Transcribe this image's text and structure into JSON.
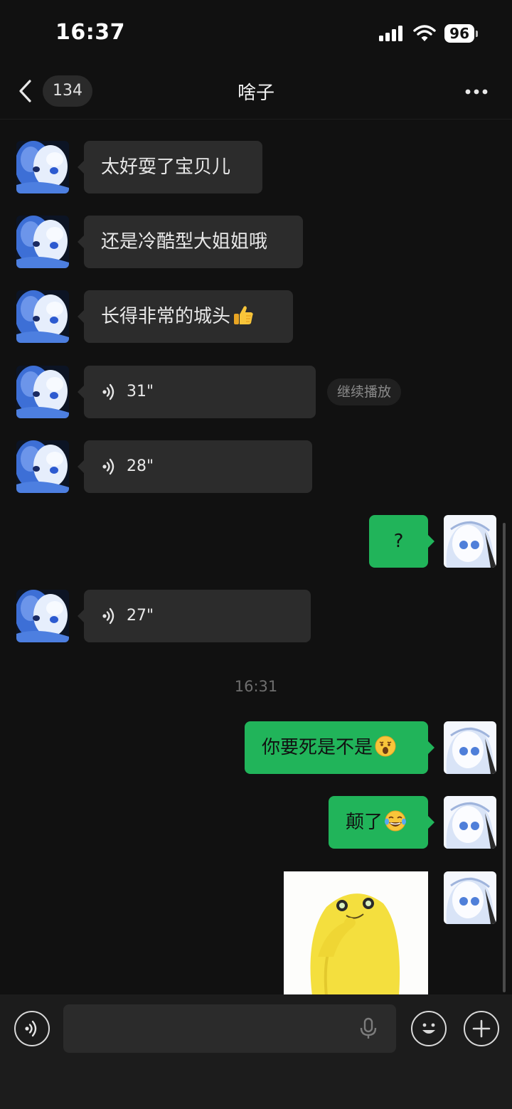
{
  "status_bar": {
    "time": "16:37",
    "battery": "96"
  },
  "nav": {
    "unread_count": "134",
    "title": "啥子"
  },
  "messages": [
    {
      "side": "in",
      "type": "text",
      "text": "太好耍了宝贝儿"
    },
    {
      "side": "in",
      "type": "text",
      "text": "还是冷酷型大姐姐哦"
    },
    {
      "side": "in",
      "type": "text",
      "text": "长得非常的城头",
      "emoji": "thumbs-up"
    },
    {
      "side": "in",
      "type": "voice",
      "duration": "31\"",
      "continue_label": "继续播放"
    },
    {
      "side": "in",
      "type": "voice",
      "duration": "28\""
    },
    {
      "side": "out",
      "type": "text",
      "text": "?"
    },
    {
      "side": "in",
      "type": "voice",
      "duration": "27\""
    },
    {
      "type": "timestamp",
      "text": "16:31"
    },
    {
      "side": "out",
      "type": "text",
      "text": "你要死是不是",
      "emoji": "shocked-face"
    },
    {
      "side": "out",
      "type": "text",
      "text": "颠了",
      "emoji": "tears-of-joy"
    },
    {
      "side": "out",
      "type": "sticker",
      "sticker": "yellow-blob-thinking"
    }
  ],
  "colors": {
    "outgoing_bubble": "#21b45a",
    "incoming_bubble": "#2c2c2c",
    "background": "#111111"
  }
}
